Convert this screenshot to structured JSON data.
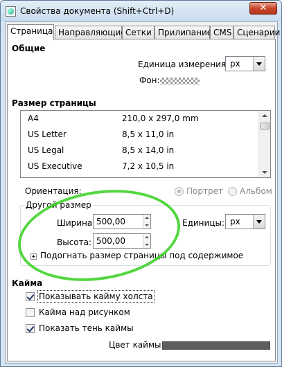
{
  "window": {
    "title": "Свойства документа (Shift+Ctrl+D)",
    "close_glyph": "✕"
  },
  "tabs": [
    "Страница",
    "Направляющие",
    "Сетки",
    "Прилипание",
    "CMS",
    "Сценарии"
  ],
  "active_tab": "Страница",
  "general": {
    "title": "Общие",
    "units_label": "Единица измерения:",
    "units_value": "px",
    "background_label": "Фон:"
  },
  "page_size": {
    "title": "Размер страницы",
    "rows": [
      {
        "name": "A4",
        "size": "210,0 x 297,0 mm"
      },
      {
        "name": "US Letter",
        "size": "8,5 x 11,0 in"
      },
      {
        "name": "US Legal",
        "size": "8,5 x 14,0 in"
      },
      {
        "name": "US Executive",
        "size": "7,2 x 10,5 in"
      }
    ],
    "orientation_label": "Ориентация:",
    "portrait_label": "Портрет",
    "landscape_label": "Альбом",
    "custom_legend": "Другой размер",
    "width_label": "Ширина:",
    "width_value": "500,00",
    "height_label": "Высота:",
    "height_value": "500,00",
    "units_label": "Единицы:",
    "units_value": "px",
    "fit_label": "Подогнать размер страницы под содержимое"
  },
  "border": {
    "title": "Кайма",
    "show_border_label": "Показывать кайму холста",
    "show_border_checked": true,
    "border_on_top_label": "Кайма над рисунком",
    "border_on_top_checked": false,
    "show_shadow_label": "Показать тень каймы",
    "show_shadow_checked": true,
    "color_label": "Цвет каймы:",
    "color_value": "#5e5e5e"
  },
  "colors": {
    "annotation_ellipse": "#36d020",
    "titlebar": "#d6e4f2"
  }
}
